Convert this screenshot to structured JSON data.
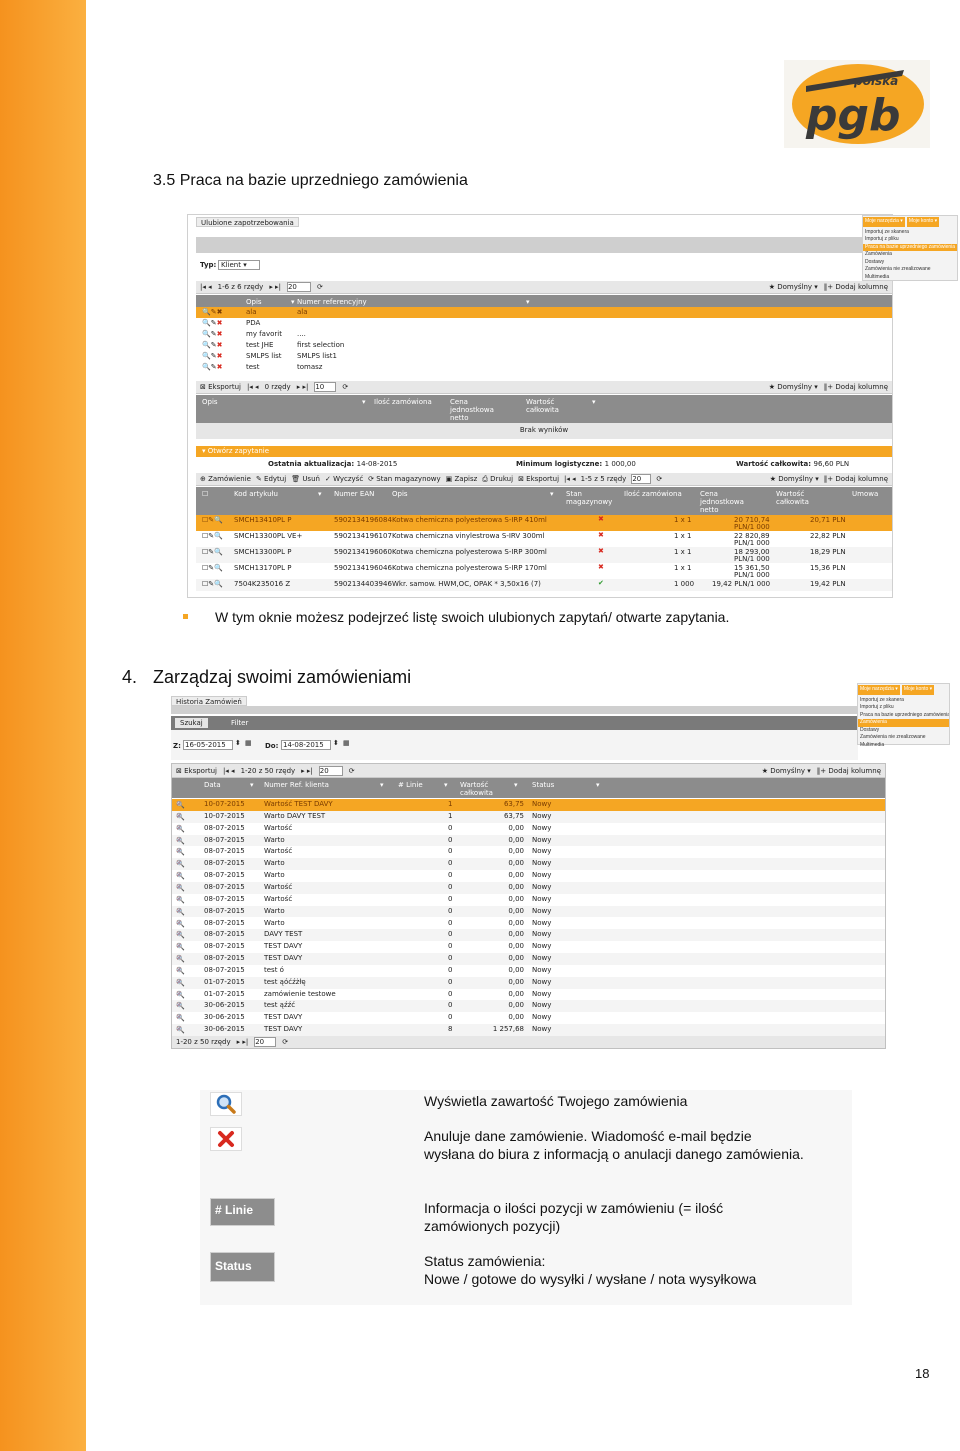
{
  "doc": {
    "heading1": "3.5  Praca na bazie uprzedniego zamówienia",
    "bullet": "W tym oknie możesz podejrzeć listę swoich ulubionych zapytań/ otwarte zapytania.",
    "heading2_num": "4.",
    "heading2": "Zarządzaj swoimi zamówieniami",
    "page_number": "18",
    "logo": {
      "top": "polska",
      "main": "pgb",
      "color": "#f5a623"
    }
  },
  "shot1": {
    "tab": "Ulubione zapotrzebowania",
    "menu_chips": [
      "Moje narzędzia ▾",
      "Moje konto ▾"
    ],
    "menu_items": [
      "Importuj ze skanera",
      "Importuj z pliku",
      "Praca na bazie uprzedniego zamówienia",
      "Zamówienia",
      "Dostawy",
      "Zamówienia nie zrealizowane",
      "Multimedia"
    ],
    "typ_label": "Typ:",
    "typ_value": "Klient",
    "pager1": "1-6 z 6 rzędy",
    "pager1_size": "20",
    "default_label": "Domyślny",
    "add_col": "Dodaj kolumnę",
    "cols1": [
      "Opis",
      "Numer referencyjny"
    ],
    "rows1": [
      [
        "ala",
        "ala"
      ],
      [
        "PDA",
        ""
      ],
      [
        "my favorit",
        "...."
      ],
      [
        "test JHE",
        "first selection"
      ],
      [
        "SMLPS list",
        "SMLPS list1"
      ],
      [
        "test",
        "tomasz"
      ]
    ],
    "export": "Eksportuj",
    "pager2": "0 rzędy",
    "pager2_size": "10",
    "cols2": [
      "Opis",
      "Ilość zamówiona",
      "Cena jednostkowa netto",
      "Wartość całkowita"
    ],
    "no_results": "Brak wyników",
    "open_label": "Otwórz zapytanie",
    "last_update_label": "Ostatnia aktualizacja:",
    "last_update": "14-08-2015",
    "min_log_label": "Minimum logistyczne:",
    "min_log": "1 000,00",
    "total_label": "Wartość całkowita:",
    "total": "96,60 PLN",
    "toolbar3": [
      "Zamówienie",
      "Edytuj",
      "Usuń",
      "Wyczyść",
      "Stan magazynowy",
      "Zapisz",
      "Drukuj",
      "Eksportuj"
    ],
    "pager3": "1-5 z 5 rzędy",
    "pager3_size": "20",
    "cols3": [
      "Kod artykułu",
      "Numer EAN",
      "Opis",
      "Stan magazynowy",
      "Ilość zamówiona",
      "Cena jednostkowa netto",
      "Wartość całkowita",
      "Umowa"
    ],
    "rows3": [
      {
        "code": "SMCH13410PL P",
        "ean": "5902134196084",
        "desc": "Kotwa chemiczna polyesterowa S-IRP 410ml",
        "stock": "x",
        "qty": "1 x 1",
        "price": "20 710,74",
        "unit": "PLN/1 000",
        "value": "20,71 PLN"
      },
      {
        "code": "SMCH13300PL VE+",
        "ean": "5902134196107",
        "desc": "Kotwa chemiczna vinylestrowa S-IRV 300ml",
        "stock": "x",
        "qty": "1 x 1",
        "price": "22 820,89",
        "unit": "PLN/1 000",
        "value": "22,82 PLN"
      },
      {
        "code": "SMCH13300PL P",
        "ean": "5902134196060",
        "desc": "Kotwa chemiczna polyesterowa S-IRP 300ml",
        "stock": "x",
        "qty": "1 x 1",
        "price": "18 293,00",
        "unit": "PLN/1 000",
        "value": "18,29 PLN"
      },
      {
        "code": "SMCH13170PL P",
        "ean": "5902134196046",
        "desc": "Kotwa chemiczna polyesterowa S-IRP 170ml",
        "stock": "x",
        "qty": "1 x 1",
        "price": "15 361,50",
        "unit": "PLN/1 000",
        "value": "15,36 PLN"
      },
      {
        "code": "7504K235016 Z",
        "ean": "5902134403946",
        "desc": "Wkr. samow. HWM,OC, OPAK * 3,50x16 (7)",
        "stock": "ok",
        "qty": "1 000",
        "price": "19,42 PLN/1 000",
        "unit": "",
        "value": "19,42 PLN"
      }
    ]
  },
  "shot2": {
    "tab": "Historia Zamówień",
    "menu_chips": [
      "Moje narzędzia ▾",
      "Moje konto ▾"
    ],
    "menu_items": [
      "Importuj ze skanera",
      "Importuj z pliku",
      "Praca na bazie uprzedniego zamówienia",
      "Zamówienia",
      "Dostawy",
      "Zamówienia nie zrealizowane",
      "Multimedia"
    ],
    "search_tab": "Szukaj",
    "filter_tab": "Filter",
    "from_label": "Z:",
    "from": "16-05-2015",
    "to_label": "Do:",
    "to": "14-08-2015",
    "export": "Eksportuj",
    "pager": "1-20 z 50 rzędy",
    "pager_size": "20",
    "default_label": "Domyślny",
    "add_col": "Dodaj kolumnę",
    "cols": [
      "Data",
      "Numer Ref. klienta",
      "# Linie",
      "Wartość całkowita",
      "Status"
    ],
    "rows": [
      [
        "10-07-2015",
        "Wartość TEST DAVY",
        "1",
        "63,75",
        "Nowy"
      ],
      [
        "10-07-2015",
        "Warto DAVY TEST",
        "1",
        "63,75",
        "Nowy"
      ],
      [
        "08-07-2015",
        "Wartość",
        "0",
        "0,00",
        "Nowy"
      ],
      [
        "08-07-2015",
        "Warto",
        "0",
        "0,00",
        "Nowy"
      ],
      [
        "08-07-2015",
        "Wartość",
        "0",
        "0,00",
        "Nowy"
      ],
      [
        "08-07-2015",
        "Warto",
        "0",
        "0,00",
        "Nowy"
      ],
      [
        "08-07-2015",
        "Warto",
        "0",
        "0,00",
        "Nowy"
      ],
      [
        "08-07-2015",
        "Wartość",
        "0",
        "0,00",
        "Nowy"
      ],
      [
        "08-07-2015",
        "Wartość",
        "0",
        "0,00",
        "Nowy"
      ],
      [
        "08-07-2015",
        "Warto",
        "0",
        "0,00",
        "Nowy"
      ],
      [
        "08-07-2015",
        "Warto",
        "0",
        "0,00",
        "Nowy"
      ],
      [
        "08-07-2015",
        "DAVY TEST",
        "0",
        "0,00",
        "Nowy"
      ],
      [
        "08-07-2015",
        "TEST DAVY",
        "0",
        "0,00",
        "Nowy"
      ],
      [
        "08-07-2015",
        "TEST DAVY",
        "0",
        "0,00",
        "Nowy"
      ],
      [
        "08-07-2015",
        "test ó",
        "0",
        "0,00",
        "Nowy"
      ],
      [
        "01-07-2015",
        "test ąóćźżłę",
        "0",
        "0,00",
        "Nowy"
      ],
      [
        "01-07-2015",
        "zamówienie testowe",
        "0",
        "0,00",
        "Nowy"
      ],
      [
        "30-06-2015",
        "test ąźźć",
        "0",
        "0,00",
        "Nowy"
      ],
      [
        "30-06-2015",
        "TEST DAVY",
        "0",
        "0,00",
        "Nowy"
      ],
      [
        "30-06-2015",
        "TEST DAVY",
        "8",
        "1 257,68",
        "Nowy"
      ]
    ],
    "footer_pager": "1-20 z 50 rzędy",
    "footer_size": "20"
  },
  "legend": {
    "items": [
      {
        "icon": "magnifier-icon",
        "text": "Wyświetla zawartość Twojego zamówienia"
      },
      {
        "icon": "cancel-x-icon",
        "text": "Anuluje dane zamówienie. Wiadomość e-mail będzie wysłana do biura z informacją o anulacji danego zamówienia."
      },
      {
        "badge": "# Linie",
        "text": "Informacja o ilości pozycji w zamówieniu (= ilość zamówionych pozycji)"
      },
      {
        "badge": "Status",
        "text": "Status zamówienia:",
        "text2": "Nowe / gotowe do wysyłki / wysłane / nota wysyłkowa"
      }
    ]
  }
}
